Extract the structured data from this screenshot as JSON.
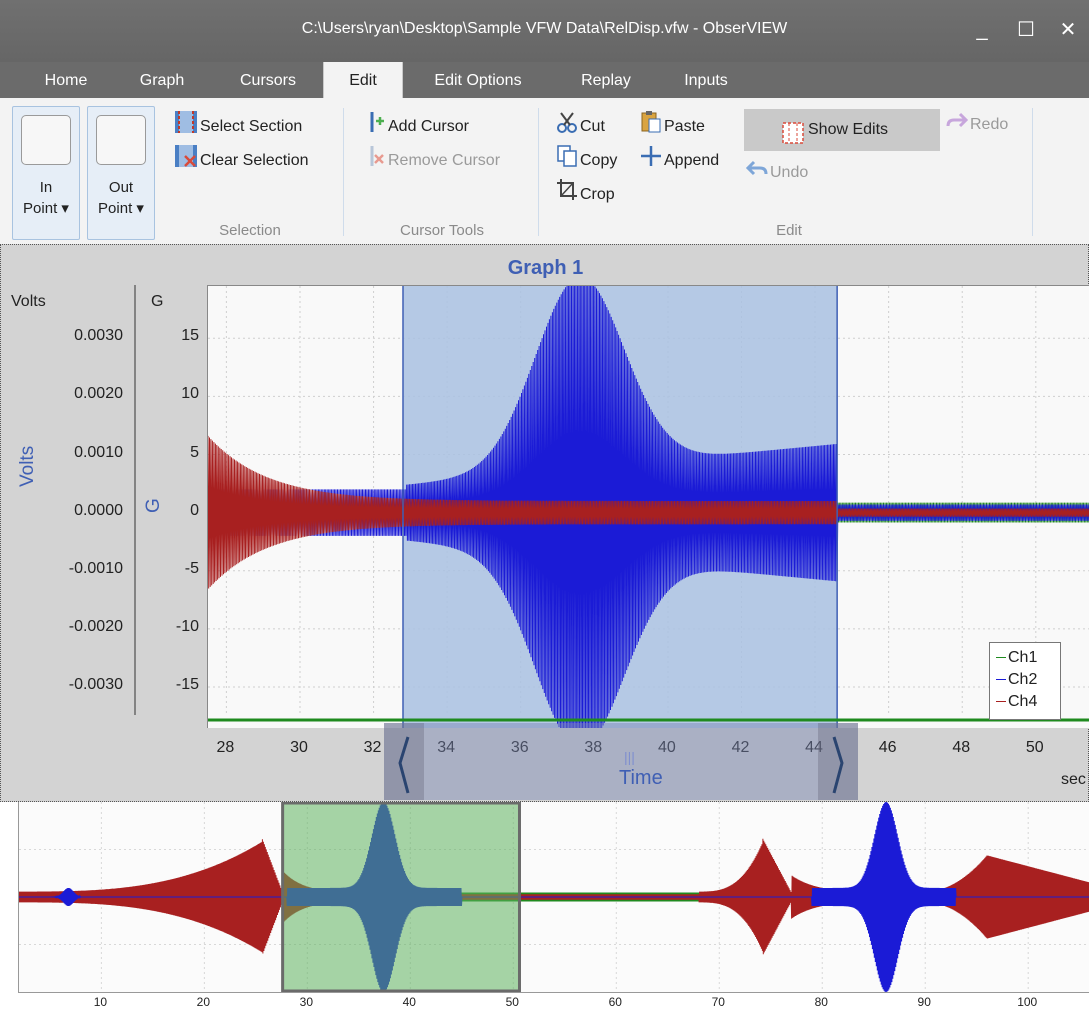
{
  "window": {
    "title": "C:\\Users\\ryan\\Desktop\\Sample VFW Data\\RelDisp.vfw - ObserVIEW",
    "minimize": "_",
    "maximize": "☐",
    "close": "✕"
  },
  "tabs": [
    {
      "label": "Home"
    },
    {
      "label": "Graph"
    },
    {
      "label": "Cursors"
    },
    {
      "label": "Edit",
      "active": true
    },
    {
      "label": "Edit Options"
    },
    {
      "label": "Replay"
    },
    {
      "label": "Inputs"
    }
  ],
  "ribbon": {
    "in_point": {
      "line1": "In",
      "line2": "Point ▾"
    },
    "out_point": {
      "line1": "Out",
      "line2": "Point ▾"
    },
    "select_section": "Select Section",
    "clear_selection": "Clear Selection",
    "selection_group": "Selection",
    "add_cursor": "Add Cursor",
    "remove_cursor": "Remove Cursor",
    "cursor_tools_group": "Cursor Tools",
    "cut": "Cut",
    "copy": "Copy",
    "crop": "Crop",
    "paste": "Paste",
    "append": "Append",
    "show_edits": "Show Edits",
    "undo": "Undo",
    "redo": "Redo",
    "edit_group": "Edit"
  },
  "graph": {
    "title": "Graph 1",
    "left_axis_label": "Volts",
    "left_axis_unit": "Volts",
    "right_axis_label": "G",
    "right_axis_unit": "G",
    "x_axis_label": "Time",
    "x_unit": "sec",
    "volts_ticks": [
      "0.0030",
      "0.0020",
      "0.0010",
      "0.0000",
      "-0.0010",
      "-0.0020",
      "-0.0030"
    ],
    "g_ticks": [
      "15",
      "10",
      "5",
      "0",
      "-5",
      "-10",
      "-15"
    ],
    "x_ticks": [
      "28",
      "30",
      "32",
      "34",
      "36",
      "38",
      "40",
      "42",
      "44",
      "46",
      "48",
      "50"
    ],
    "scroll_grip": "|||",
    "selection": {
      "start_sec": 32.8,
      "end_sec": 44.6
    },
    "view_range_sec": [
      27.5,
      51.5
    ],
    "g_range": [
      -17.5,
      19.5
    ]
  },
  "legend": [
    {
      "name": "Ch1",
      "color": "#1f8a1f"
    },
    {
      "name": "Ch2",
      "color": "#1b1bd6"
    },
    {
      "name": "Ch4",
      "color": "#a82020"
    }
  ],
  "overview": {
    "x_ticks": [
      "10",
      "20",
      "30",
      "40",
      "50",
      "60",
      "70",
      "80",
      "90",
      "100"
    ],
    "x_range_sec": [
      2,
      106
    ],
    "window_sec": [
      27.6,
      50.6
    ]
  },
  "colors": {
    "selection": "#a9c1e2",
    "ch1": "#1f8a1f",
    "ch2": "#1b1bd6",
    "ch4": "#a82020",
    "title": "#3f5fb4"
  }
}
